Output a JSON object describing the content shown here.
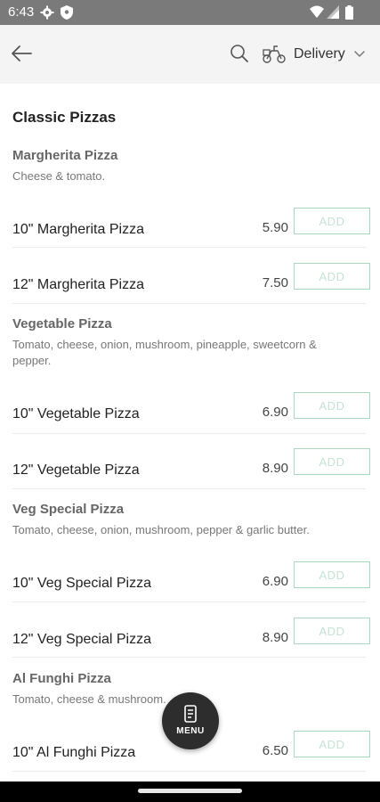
{
  "status_bar": {
    "time": "6:43"
  },
  "header": {
    "delivery_label": "Delivery"
  },
  "section_title": "Classic Pizzas",
  "groups": [
    {
      "name": "Margherita Pizza",
      "description": "Cheese & tomato.",
      "items": [
        {
          "name": "10\" Margherita Pizza",
          "price": "5.90",
          "button": "ADD"
        },
        {
          "name": "12\" Margherita Pizza",
          "price": "7.50",
          "button": "ADD"
        }
      ]
    },
    {
      "name": "Vegetable Pizza",
      "description": "Tomato, cheese, onion, mushroom, pineapple, sweetcorn & pepper.",
      "items": [
        {
          "name": "10\" Vegetable Pizza",
          "price": "6.90",
          "button": "ADD"
        },
        {
          "name": "12\" Vegetable Pizza",
          "price": "8.90",
          "button": "ADD"
        }
      ]
    },
    {
      "name": "Veg Special Pizza",
      "description": "Tomato, cheese, onion, mushroom, pepper & garlic butter.",
      "items": [
        {
          "name": "10\" Veg Special Pizza",
          "price": "6.90",
          "button": "ADD"
        },
        {
          "name": "12\" Veg Special Pizza",
          "price": "8.90",
          "button": "ADD"
        }
      ]
    },
    {
      "name": "Al Funghi Pizza",
      "description": "Tomato, cheese & mushroom.",
      "items": [
        {
          "name": "10\" Al Funghi Pizza",
          "price": "6.50",
          "button": "ADD"
        }
      ]
    }
  ],
  "menu_button": {
    "label": "MENU"
  },
  "colors": {
    "accent_border": "#a9d7c0",
    "add_text": "#c6e3d5",
    "status_bar": "#7a7a7a",
    "fab": "#2d2d2d"
  }
}
